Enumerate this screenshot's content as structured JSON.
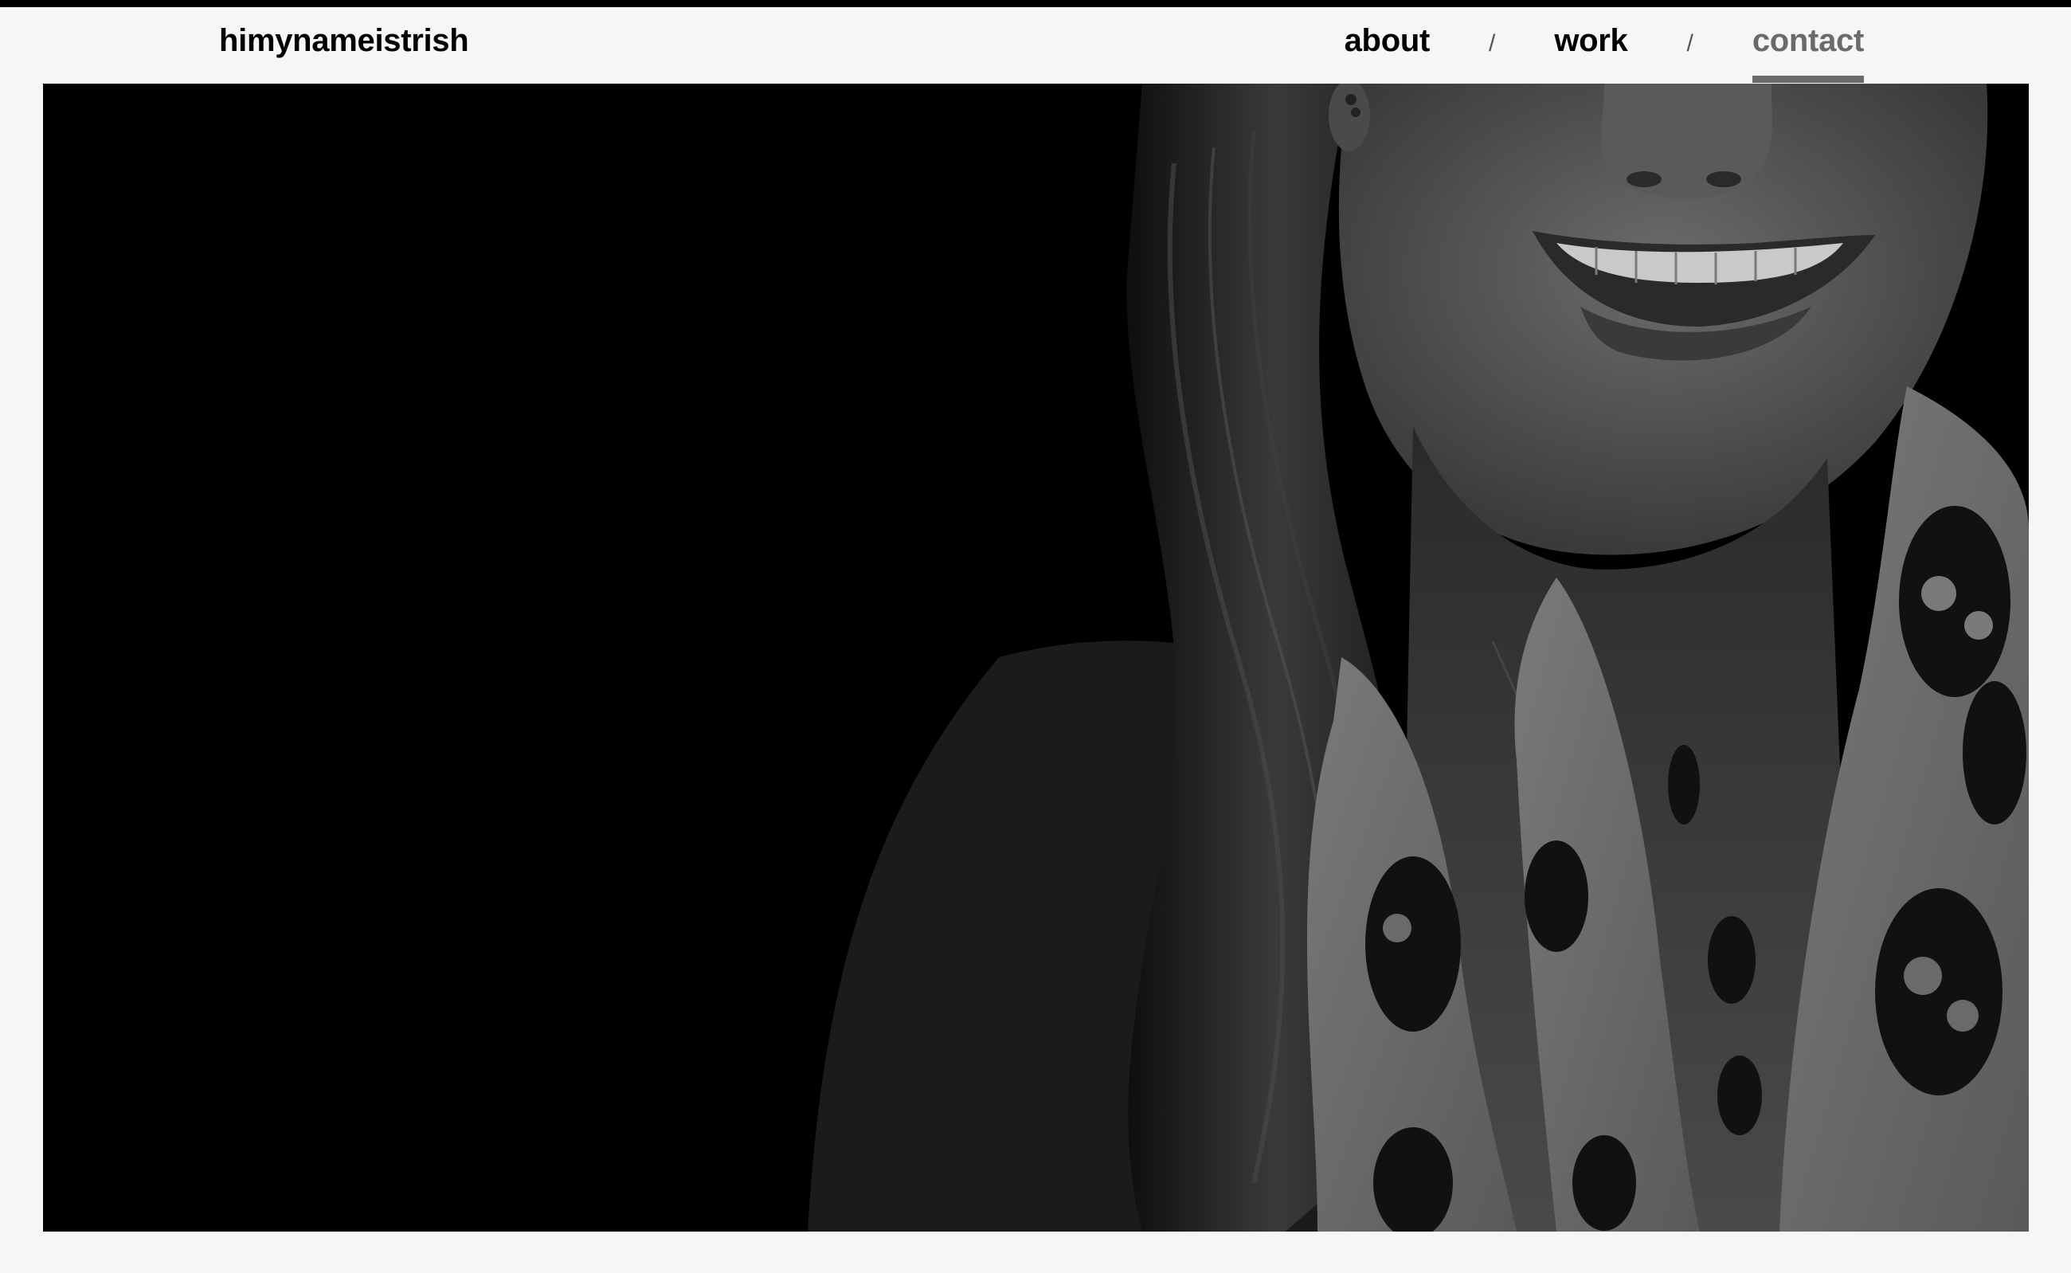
{
  "site": {
    "logo": "himynameistrish"
  },
  "nav": {
    "items": [
      {
        "label": "about",
        "active": false
      },
      {
        "label": "work",
        "active": false
      },
      {
        "label": "contact",
        "active": true
      }
    ],
    "separator": "/"
  },
  "hero": {
    "description_icon": "portrait-photo",
    "palette": {
      "background": "#000000",
      "page": "#f6f6f6",
      "accent": "#6a6a6a"
    }
  }
}
